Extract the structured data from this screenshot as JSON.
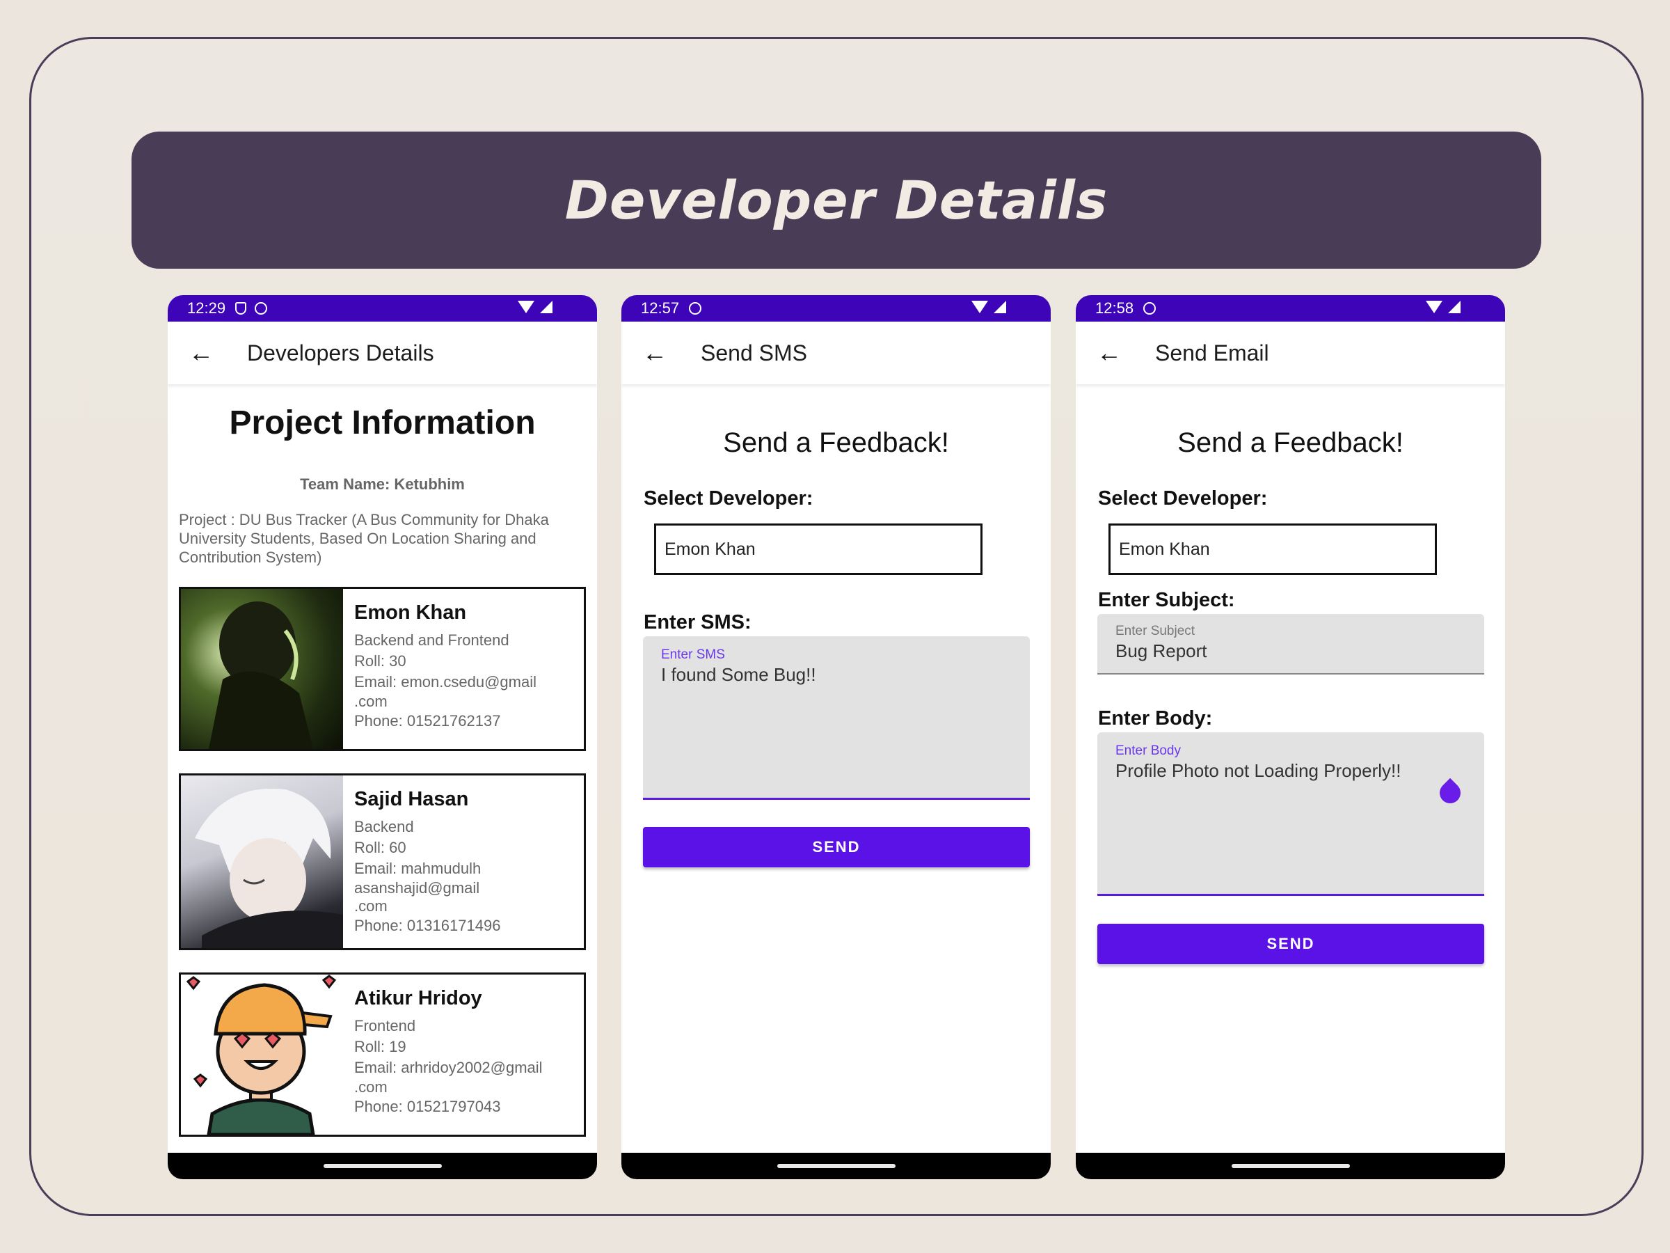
{
  "banner": {
    "title": "Developer Details"
  },
  "phone1": {
    "status": {
      "time": "12:29"
    },
    "appbar": {
      "title": "Developers Details"
    },
    "heading": "Project Information",
    "team": "Team Name: Ketubhim",
    "project": "Project : DU Bus Tracker (A Bus Community for Dhaka University Students, Based On Location Sharing and Contribution System)",
    "developers": [
      {
        "name": "Emon Khan",
        "role": "Backend and Frontend",
        "roll": "Roll: 30",
        "email1": "Email: emon.csedu@gmail",
        "email2": ".com",
        "email3": "",
        "phone": "Phone: 01521762137"
      },
      {
        "name": "Sajid Hasan",
        "role": "Backend",
        "roll": "Roll: 60",
        "email1": "Email: mahmudulh",
        "email2": "asanshajid@gmail",
        "email3": ".com",
        "phone": "Phone: 01316171496"
      },
      {
        "name": "Atikur Hridoy",
        "role": "Frontend",
        "roll": "Roll: 19",
        "email1": "Email: arhridoy2002@gmail",
        "email2": ".com",
        "email3": "",
        "phone": "Phone: 01521797043"
      }
    ]
  },
  "phone2": {
    "status": {
      "time": "12:57"
    },
    "appbar": {
      "title": "Send SMS"
    },
    "heading": "Send a Feedback!",
    "select_label": "Select Developer:",
    "select_value": "Emon Khan",
    "sms_label": "Enter SMS:",
    "sms_field_label": "Enter SMS",
    "sms_value": "I found Some Bug!!",
    "send": "SEND"
  },
  "phone3": {
    "status": {
      "time": "12:58"
    },
    "appbar": {
      "title": "Send Email"
    },
    "heading": "Send a Feedback!",
    "select_label": "Select Developer:",
    "select_value": "Emon Khan",
    "subject_label": "Enter Subject:",
    "subject_field_label": "Enter Subject",
    "subject_value": "Bug Report",
    "body_label": "Enter Body:",
    "body_field_label": "Enter Body",
    "body_value": "Profile Photo not Loading Properly!!",
    "send": "SEND"
  },
  "colors": {
    "accent": "#5b12e6",
    "statusbar": "#3e04b8",
    "banner": "#483c56"
  }
}
